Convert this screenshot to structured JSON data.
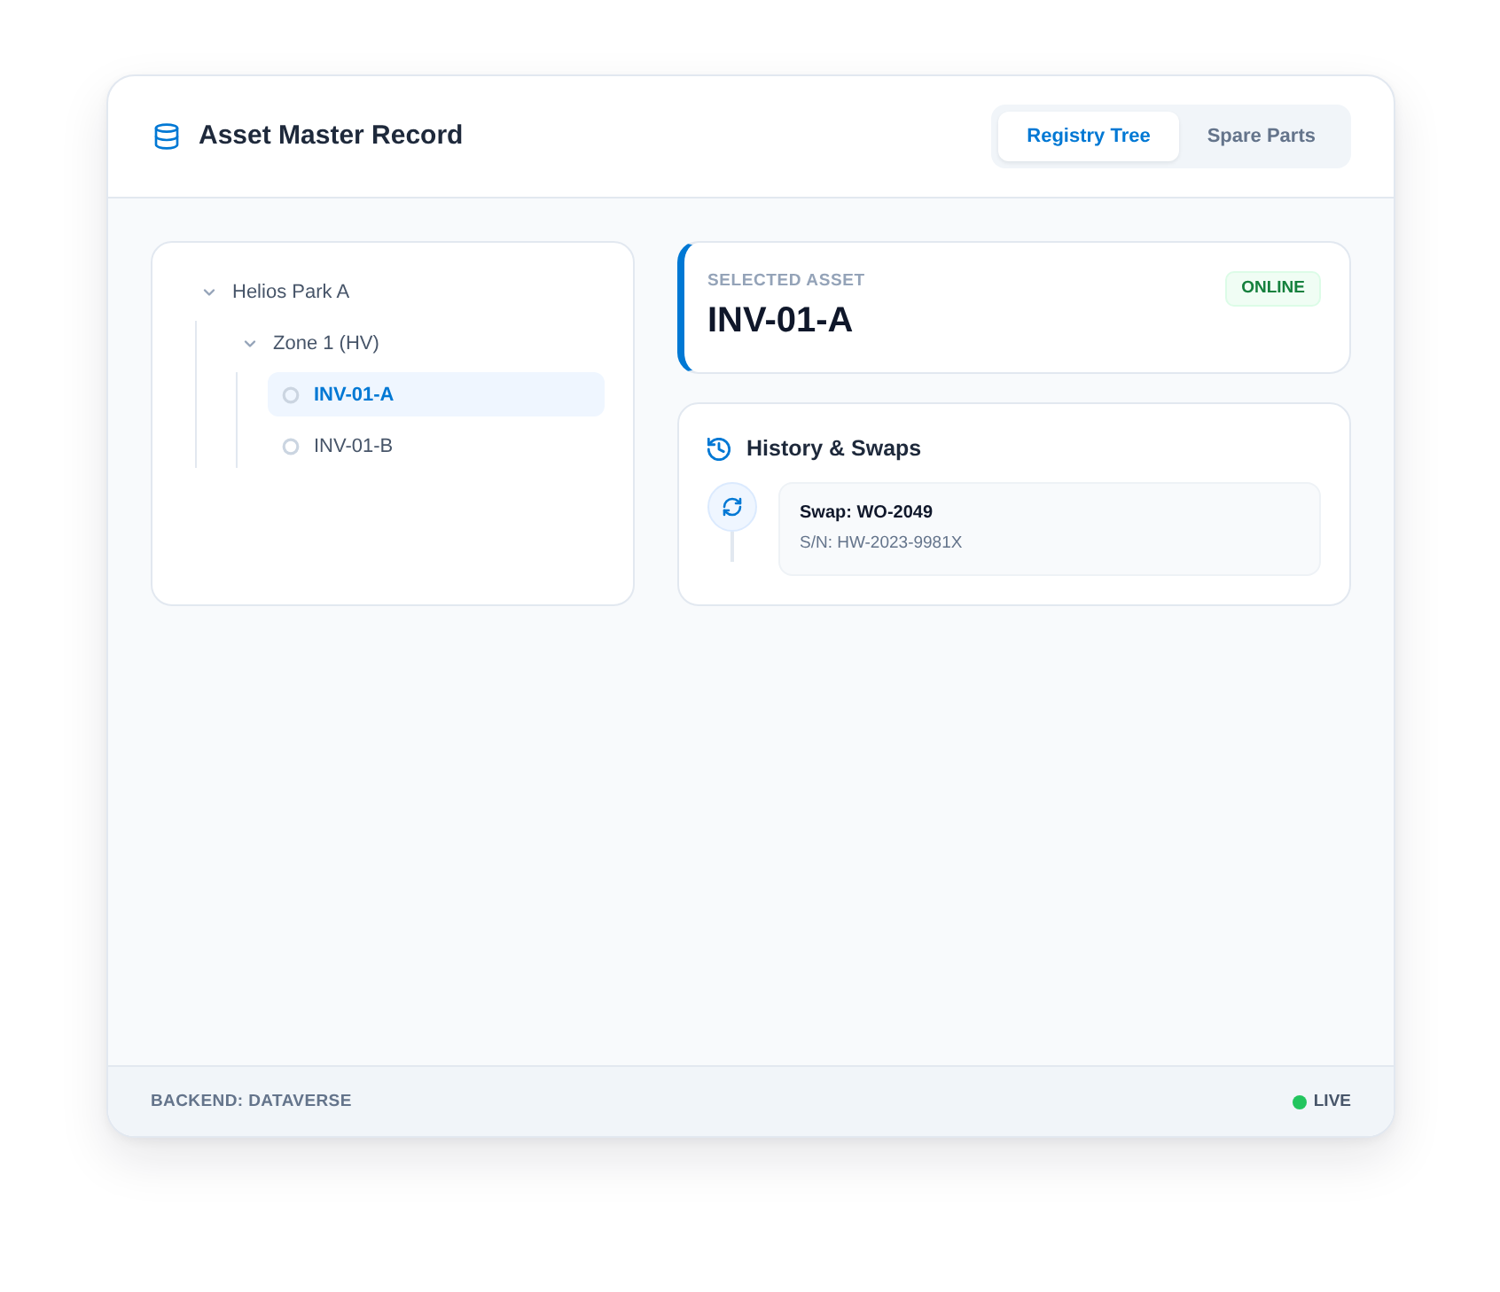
{
  "header": {
    "title": "Asset Master Record",
    "tabs": [
      {
        "label": "Registry Tree",
        "selected": true
      },
      {
        "label": "Spare Parts",
        "selected": false
      }
    ]
  },
  "tree": [
    {
      "kind": "group",
      "label": "Helios Park A",
      "expanded": true,
      "selected": false,
      "children": [
        {
          "kind": "group",
          "label": "Zone 1 (HV)",
          "expanded": true,
          "selected": false,
          "children": [
            {
              "kind": "asset",
              "label": "INV-01-A",
              "selected": true
            },
            {
              "kind": "asset",
              "label": "INV-01-B",
              "selected": false
            }
          ]
        }
      ]
    }
  ],
  "selected_asset": {
    "label": "SELECTED ASSET",
    "name": "INV-01-A",
    "status": "ONLINE"
  },
  "history": {
    "title": "History & Swaps",
    "entries": [
      {
        "title": "Swap: WO-2049",
        "serial": "S/N: HW-2023-9981X"
      }
    ]
  },
  "status_bar": {
    "backend": "BACKEND: DATAVERSE",
    "connection": "LIVE"
  }
}
